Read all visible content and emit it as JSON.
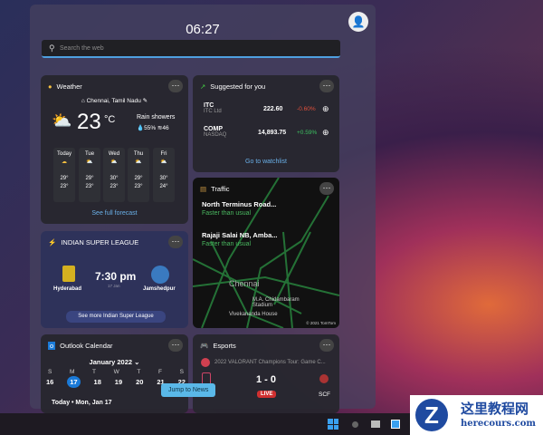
{
  "header": {
    "time": "06:27",
    "search_placeholder": "Search the web"
  },
  "weather": {
    "title": "Weather",
    "location": "Chennai, Tamil Nadu",
    "temp": "23",
    "unit": "°C",
    "condition": "Rain showers",
    "humidity": "55%",
    "aqi": "46",
    "days": [
      {
        "d": "Today",
        "hi": "29°",
        "lo": "23°"
      },
      {
        "d": "Tue",
        "hi": "29°",
        "lo": "23°"
      },
      {
        "d": "Wed",
        "hi": "30°",
        "lo": "23°"
      },
      {
        "d": "Thu",
        "hi": "29°",
        "lo": "23°"
      },
      {
        "d": "Fri",
        "hi": "30°",
        "lo": "24°"
      }
    ],
    "link": "See full forecast"
  },
  "stocks": {
    "title": "Suggested for you",
    "items": [
      {
        "sym": "ITC",
        "name": "ITC Ltd",
        "price": "222.60",
        "chg": "-0.60%"
      },
      {
        "sym": "COMP",
        "name": "NASDAQ",
        "price": "14,893.75",
        "chg": "+0.59%"
      }
    ],
    "link": "Go to watchlist",
    "neg": "#e0503c",
    "pos": "#3cc060"
  },
  "traffic": {
    "title": "Traffic",
    "routes": [
      {
        "road": "North Terminus Road...",
        "status": "Faster than usual"
      },
      {
        "road": "Rajaji Salai NB, Amba...",
        "status": "Faster than usual"
      }
    ],
    "map_labels": [
      "Chennai",
      "M.A. Chidambaram Stadium",
      "Vivekananda House"
    ],
    "copyright": "© 2021 TomTom"
  },
  "isl": {
    "title": "INDIAN SUPER LEAGUE",
    "home": "Hyderabad",
    "away": "Jamshedpur",
    "time": "7:30 pm",
    "date": "17 Jan",
    "link": "See more Indian Super League"
  },
  "calendar": {
    "title": "Outlook Calendar",
    "month": "January 2022",
    "weekdays": [
      "S",
      "M",
      "T",
      "W",
      "T",
      "F",
      "S"
    ],
    "dates": [
      "16",
      "17",
      "18",
      "19",
      "20",
      "21",
      "22"
    ],
    "today": "Today • Mon, Jan 17"
  },
  "esports": {
    "title": "Esports",
    "event": "2022 VALORANT Champions Tour: Game C...",
    "score": "1 - 0",
    "live": "LIVE",
    "team2": "SCF"
  },
  "tooltip": "Jump to News",
  "watermark": {
    "cn": "这里教程网",
    "url": "herecours.com"
  }
}
